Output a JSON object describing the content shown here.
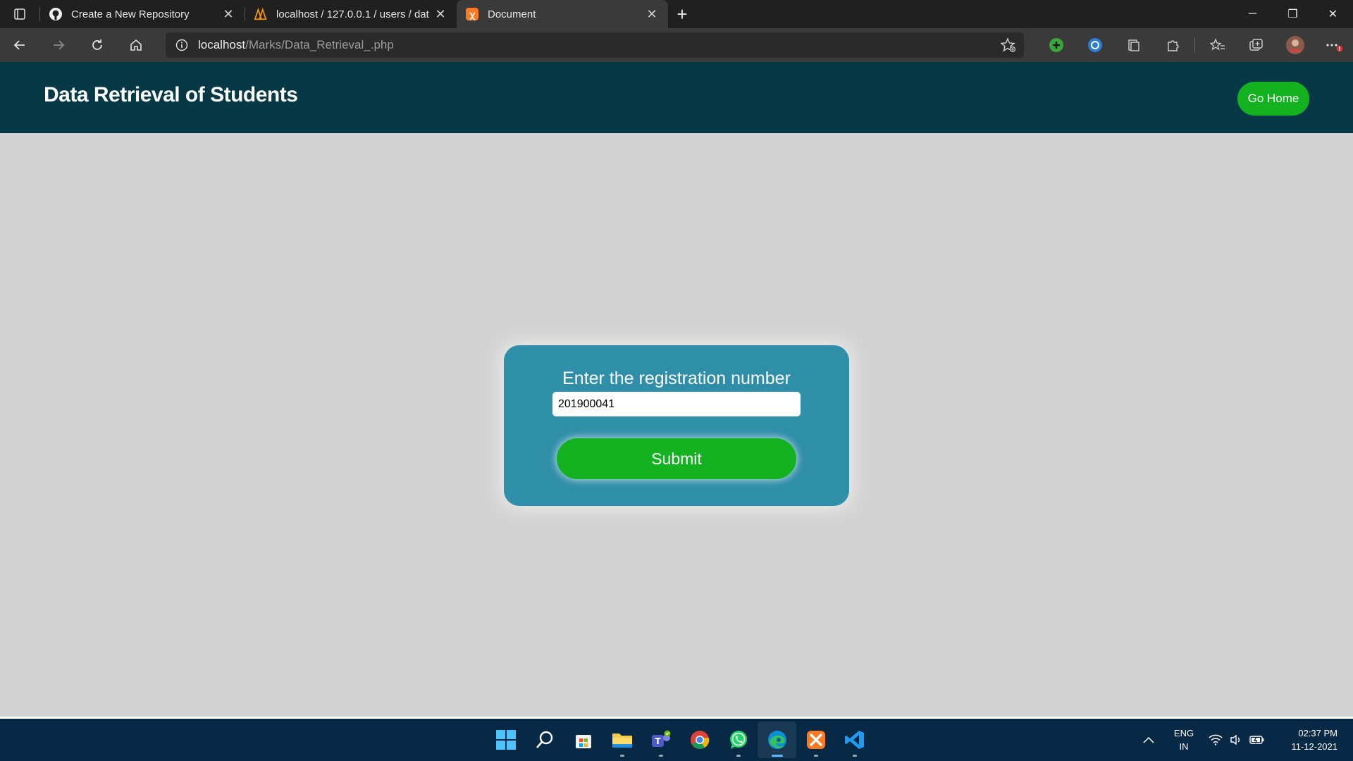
{
  "browser": {
    "tabs": [
      {
        "title": "Create a New Repository",
        "icon": "github-icon",
        "active": false
      },
      {
        "title": "localhost / 127.0.0.1 / users / dat",
        "icon": "phpmyadmin-icon",
        "active": false
      },
      {
        "title": "Document",
        "icon": "xampp-icon",
        "active": true
      }
    ],
    "address": {
      "host": "localhost",
      "path": "/Marks/Data_Retrieval_.php"
    }
  },
  "header": {
    "title": "Data Retrieval of Students",
    "go_home": "Go Home"
  },
  "form": {
    "label": "Enter the registration number",
    "registration_value": "201900041",
    "submit_label": "Submit"
  },
  "taskbar": {
    "apps": [
      "windows-start-icon",
      "search-icon",
      "microsoft-store-icon",
      "file-explorer-icon",
      "teams-icon",
      "chrome-icon",
      "whatsapp-icon",
      "edge-icon",
      "xampp-icon",
      "vscode-icon"
    ],
    "lang_top": "ENG",
    "lang_bottom": "IN",
    "time": "02:37 PM",
    "date": "11-12-2021"
  },
  "colors": {
    "header_bg": "#063845",
    "card_bg": "#2f8ea8",
    "button_green": "#13b221",
    "page_bg": "#d3d3d3",
    "taskbar_bg": "#082945"
  }
}
